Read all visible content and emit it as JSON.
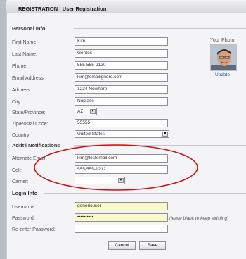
{
  "header": {
    "title": "REGISTRATION : User Registration"
  },
  "personal_info": {
    "section_title": "Personal Info",
    "first_name": {
      "label": "First Name:",
      "value": "Kim"
    },
    "last_name": {
      "label": "Last Name:",
      "value": "Gentes"
    },
    "phone": {
      "label": "Phone:",
      "value": "555-555-2120"
    },
    "email": {
      "label": "Email Address:",
      "value": "kim@emailignore.com"
    },
    "address": {
      "label": "Address:",
      "value": "1234 Nowhere"
    },
    "city": {
      "label": "City:",
      "value": "Noplace"
    },
    "state": {
      "label": "State/Province:",
      "value": "AZ"
    },
    "zip": {
      "label": "Zip/Postal Code:",
      "value": "55555"
    },
    "country": {
      "label": "Country:",
      "value": "United States"
    }
  },
  "photo": {
    "label": "Your Photo:",
    "update_link": "Update"
  },
  "notifications": {
    "section_title": "Addt'l Notifications",
    "alt_email": {
      "label": "Alternate Email:",
      "value": "kim@lostemail.com"
    },
    "cell": {
      "label": "Cell:",
      "value": "555-555-1212"
    },
    "carrier": {
      "label": "Carrier:",
      "value": ""
    }
  },
  "login": {
    "section_title": "Login Info",
    "username": {
      "label": "Username:",
      "value": "genericuser"
    },
    "password": {
      "label": "Password:",
      "value": "••••••••••",
      "note": "(leave blank to keep existing)"
    },
    "reenter": {
      "label": "Re-enter Password:",
      "value": ""
    }
  },
  "buttons": {
    "cancel": "Cancel",
    "save": "Save"
  },
  "annotation": {
    "ellipse_color": "#cc1111"
  }
}
